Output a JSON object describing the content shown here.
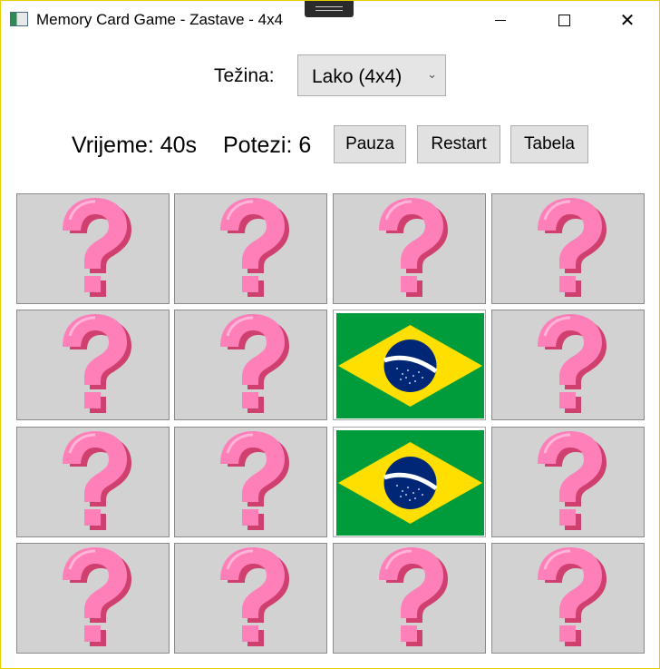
{
  "window": {
    "title": "Memory Card Game - Zastave - 4x4",
    "minimize_icon": "minimize-icon",
    "maximize_icon": "maximize-icon",
    "close_icon": "close-icon",
    "close_glyph": "✕"
  },
  "difficulty": {
    "label": "Težina:",
    "selected": "Lako (4x4)",
    "arrow": "⌄"
  },
  "stats": {
    "time": "Vrijeme: 40s",
    "moves": "Potezi: 6"
  },
  "buttons": {
    "pause": "Pauza",
    "restart": "Restart",
    "table": "Tabela"
  },
  "colors": {
    "card_back": "#d2d2d2",
    "question_pink": "#ff7fb8",
    "question_shadow": "#d0406f",
    "flag_green": "#009c3b",
    "flag_yellow": "#ffdf00",
    "flag_blue": "#002776"
  },
  "board": {
    "rows": 4,
    "cols": 4,
    "cards": [
      [
        "hidden",
        "hidden",
        "hidden",
        "hidden"
      ],
      [
        "hidden",
        "hidden",
        "brazil",
        "hidden"
      ],
      [
        "hidden",
        "hidden",
        "brazil",
        "hidden"
      ],
      [
        "hidden",
        "hidden",
        "hidden",
        "hidden"
      ]
    ]
  }
}
